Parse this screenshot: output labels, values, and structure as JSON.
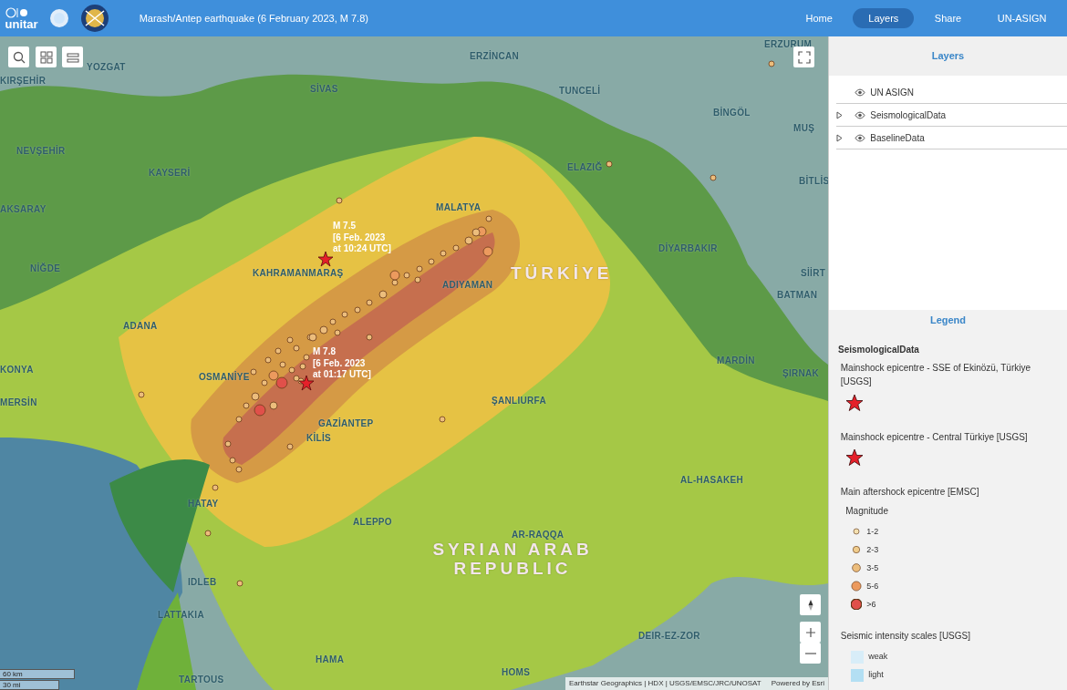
{
  "header": {
    "logo_text": "unitar",
    "title": "Marash/Antep earthquake (6 February 2023, M 7.8)",
    "nav": [
      {
        "label": "Home",
        "selected": false
      },
      {
        "label": "Layers",
        "selected": true
      },
      {
        "label": "Share",
        "selected": false
      },
      {
        "label": "UN-ASIGN",
        "selected": false
      }
    ]
  },
  "map": {
    "place_labels": [
      {
        "kind": "city",
        "text": "YOZGAT"
      },
      {
        "kind": "city",
        "text": "ERZİNCAN"
      },
      {
        "kind": "city",
        "text": "ERZURUM"
      },
      {
        "kind": "city",
        "text": "KIRŞEHİR"
      },
      {
        "kind": "city",
        "text": "SİVAS"
      },
      {
        "kind": "city",
        "text": "TUNCELİ"
      },
      {
        "kind": "city",
        "text": "BİNGÖL"
      },
      {
        "kind": "city",
        "text": "MUŞ"
      },
      {
        "kind": "city",
        "text": "NEVŞEHİR"
      },
      {
        "kind": "city",
        "text": "KAYSERİ"
      },
      {
        "kind": "city",
        "text": "ELAZIĞ"
      },
      {
        "kind": "city",
        "text": "BİTLİS"
      },
      {
        "kind": "city",
        "text": "MALATYA"
      },
      {
        "kind": "city",
        "text": "AKSARAY"
      },
      {
        "kind": "city",
        "text": "DİYARBAKIR"
      },
      {
        "kind": "city",
        "text": "NİĞDE"
      },
      {
        "kind": "city",
        "text": "KAHRAMANMARAŞ"
      },
      {
        "kind": "country",
        "text": "TÜRKİYE"
      },
      {
        "kind": "city",
        "text": "SİİRT"
      },
      {
        "kind": "city",
        "text": "ADIYAMAN"
      },
      {
        "kind": "city",
        "text": "BATMAN"
      },
      {
        "kind": "city",
        "text": "ADANA"
      },
      {
        "kind": "city",
        "text": "OSMANİYE"
      },
      {
        "kind": "city",
        "text": "MARDİN"
      },
      {
        "kind": "city",
        "text": "KONYA"
      },
      {
        "kind": "city",
        "text": "ŞANLIURFA"
      },
      {
        "kind": "city",
        "text": "ŞIRNAK"
      },
      {
        "kind": "city",
        "text": "MERSİN"
      },
      {
        "kind": "city",
        "text": "GAZİANTEP"
      },
      {
        "kind": "city",
        "text": "KİLİS"
      },
      {
        "kind": "city",
        "text": "AL-HASAKEH"
      },
      {
        "kind": "city",
        "text": "HATAY"
      },
      {
        "kind": "city",
        "text": "ALEPPO"
      },
      {
        "kind": "city",
        "text": "AR-RAQQA"
      },
      {
        "kind": "country",
        "text": "SYRIAN ARAB REPUBLIC"
      },
      {
        "kind": "city",
        "text": "IDLEB"
      },
      {
        "kind": "city",
        "text": "LATTAKIA"
      },
      {
        "kind": "city",
        "text": "DEIR-EZ-ZOR"
      },
      {
        "kind": "city",
        "text": "HAMA"
      },
      {
        "kind": "city",
        "text": "TARTOUS"
      },
      {
        "kind": "city",
        "text": "HOMS"
      }
    ],
    "epicentres": [
      {
        "lines": [
          "M 7.5",
          "[6 Feb. 2023",
          "at 10:24 UTC]"
        ]
      },
      {
        "lines": [
          "M 7.8",
          "[6 Feb. 2023",
          "at 01:17 UTC]"
        ]
      }
    ],
    "scale": [
      "60 km",
      "30 mi"
    ],
    "attribution": "Earthstar Geographics | HDX | USGS/EMSC/JRC/UNOSAT",
    "powered_by": "Powered by Esri"
  },
  "layers_panel": {
    "title": "Layers",
    "items": [
      {
        "label": "UN ASIGN",
        "expandable": false
      },
      {
        "label": "SeismologicalData",
        "expandable": true
      },
      {
        "label": "BaselineData",
        "expandable": true
      }
    ]
  },
  "legend": {
    "title": "Legend",
    "group": "SeismologicalData",
    "entries": [
      {
        "kind": "star",
        "label": "Mainshock epicentre - SSE of Ekinözü, Türkiye [USGS]"
      },
      {
        "kind": "star",
        "label": "Mainshock epicentre - Central Türkiye [USGS]"
      },
      {
        "kind": "circles",
        "label": "Main aftershock epicentre [EMSC]",
        "subtitle": "Magnitude",
        "classes": [
          {
            "label": "1-2",
            "color": "#f4e0b0"
          },
          {
            "label": "2-3",
            "color": "#f0cc8c"
          },
          {
            "label": "3-5",
            "color": "#ecbd7c"
          },
          {
            "label": "5-6",
            "color": "#ec9a5e"
          },
          {
            "label": ">6",
            "color": "#e0504a"
          }
        ]
      },
      {
        "kind": "swatches",
        "label": "Seismic intensity scales [USGS]",
        "classes": [
          {
            "label": "weak",
            "color": "#d8edf8"
          },
          {
            "label": "light",
            "color": "#b3dff3"
          }
        ]
      }
    ]
  }
}
